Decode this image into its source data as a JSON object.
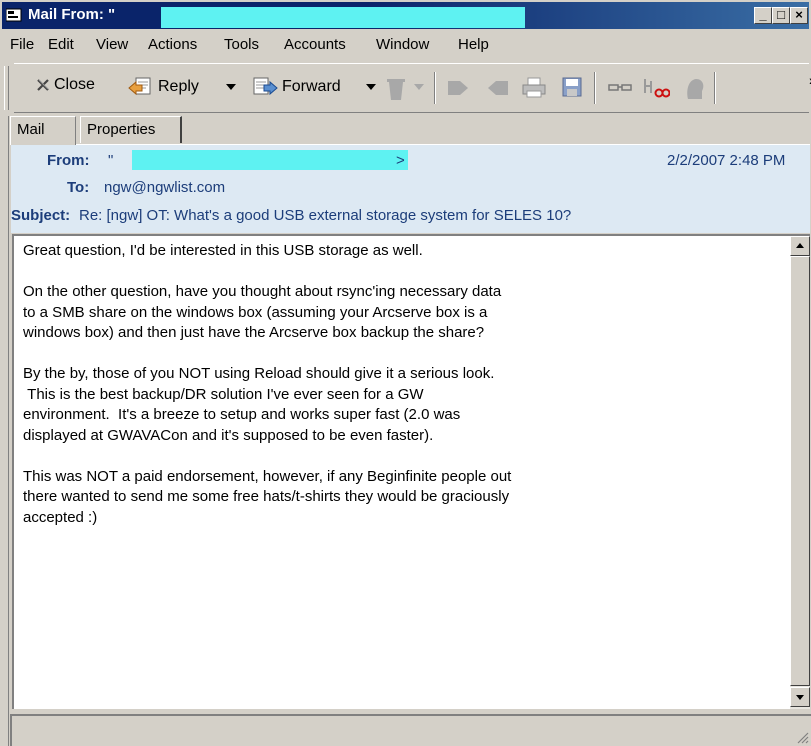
{
  "window": {
    "title": "Mail From: \"",
    "min_label": "_",
    "max_label": "□",
    "close_label": "×"
  },
  "menu": [
    "File",
    "Edit",
    "View",
    "Actions",
    "Tools",
    "Accounts",
    "Window",
    "Help"
  ],
  "toolbar": {
    "close_label": "Close",
    "reply_label": "Reply",
    "forward_label": "Forward",
    "overflow_label": "»"
  },
  "tabs": [
    "Mail",
    "Properties"
  ],
  "header": {
    "from_label": "From:",
    "from_value_prefix": "\"",
    "from_value_suffix": ">",
    "date": "2/2/2007 2:48 PM",
    "to_label": "To:",
    "to_value": "ngw@ngwlist.com",
    "subject_label": "Subject:",
    "subject_value": "Re: [ngw] OT: What's a good USB external storage system for SELES 10?"
  },
  "body": {
    "text": "Great question, I'd be interested in this USB storage as well.\n\nOn the other question, have you thought about rsync'ing necessary data\nto a SMB share on the windows box (assuming your Arcserve box is a\nwindows box) and then just have the Arcserve box backup the share?\n\nBy the by, those of you NOT using Reload should give it a serious look.\n This is the best backup/DR solution I've ever seen for a GW\nenvironment.  It's a breeze to setup and works super fast (2.0 was\ndisplayed at GWAVACon and it's supposed to be even faster).\n\nThis was NOT a paid endorsement, however, if any Beginfinite people out\nthere wanted to send me some free hats/t-shirts they would be graciously\naccepted :)"
  },
  "colors": {
    "title_bar": "#0a246a",
    "redaction": "#5ef2f2",
    "header_bg": "#dde9f3",
    "header_text": "#1c3d7a"
  }
}
